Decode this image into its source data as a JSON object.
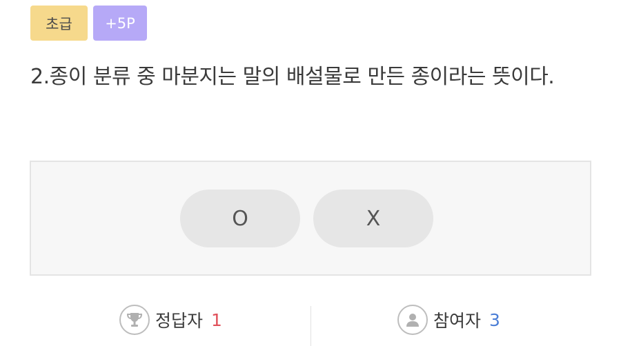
{
  "badges": {
    "level": "초급",
    "points": "+5P"
  },
  "question": {
    "text": "2.종이 분류 중 마분지는 말의 배설물로 만든 종이라는 뜻이다."
  },
  "answers": {
    "o_label": "O",
    "x_label": "X"
  },
  "stats": {
    "correct_label": "정답자",
    "correct_count": "1",
    "participants_label": "참여자",
    "participants_count": "3"
  },
  "icons": {
    "trophy": "trophy-icon",
    "user": "user-icon"
  },
  "colors": {
    "level_badge": "#f6d98c",
    "points_badge": "#b6a9f7",
    "correct_count": "#e0505a",
    "participants_count": "#4b7ed6"
  }
}
